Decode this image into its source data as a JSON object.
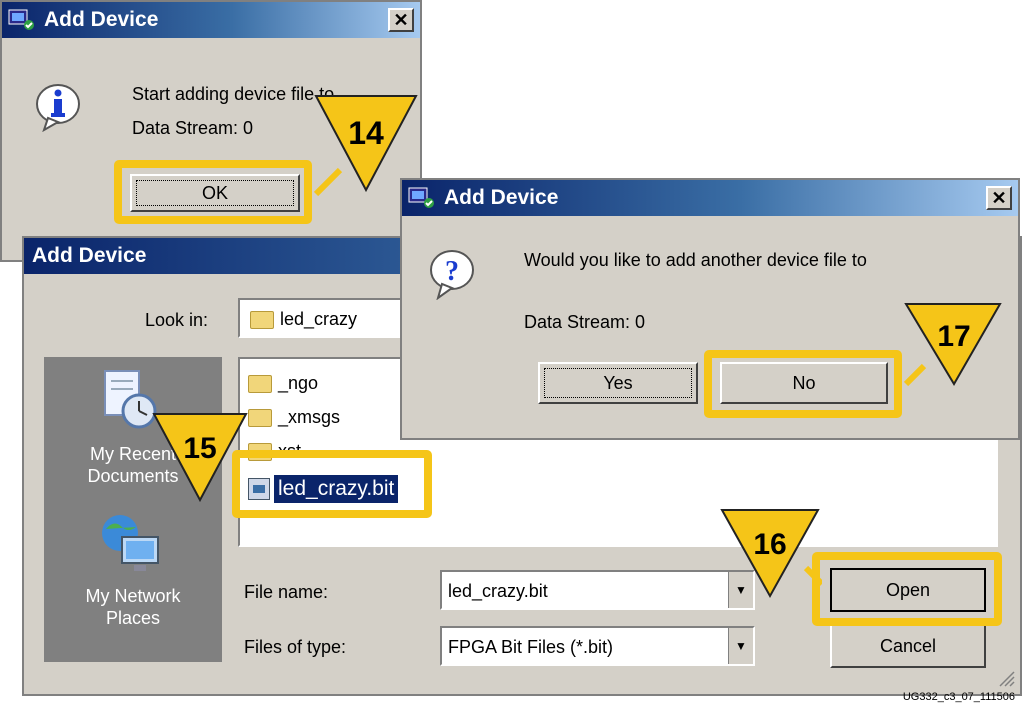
{
  "dialog_info": {
    "title": "Add Device",
    "message_line1": "Start adding device file to",
    "message_line2": "Data Stream: 0",
    "ok_label": "OK"
  },
  "dialog_open": {
    "title": "Add Device",
    "look_in_label": "Look in:",
    "look_in_value": "led_crazy",
    "places": [
      {
        "label_line1": "My Recent",
        "label_line2": "Documents",
        "icon": "recent-documents-icon"
      },
      {
        "label_line1": "My Network",
        "label_line2": "Places",
        "icon": "network-places-icon"
      }
    ],
    "files": [
      {
        "name": "_ngo",
        "icon": "folder-icon"
      },
      {
        "name": "_xmsgs",
        "icon": "folder-icon"
      },
      {
        "name": "xst",
        "icon": "folder-icon"
      },
      {
        "name": "led_crazy.bit",
        "icon": "bit-file-icon",
        "selected": true
      }
    ],
    "file_name_label": "File name:",
    "file_name_value": "led_crazy.bit",
    "files_of_type_label": "Files of type:",
    "files_of_type_value": "FPGA Bit Files (*.bit)",
    "open_label": "Open",
    "cancel_label": "Cancel"
  },
  "dialog_question": {
    "title": "Add Device",
    "message_line1": "Would you like to add another device file to",
    "message_line2": "Data Stream: 0",
    "yes_label": "Yes",
    "no_label": "No"
  },
  "callouts": {
    "c14": "14",
    "c15": "15",
    "c16": "16",
    "c17": "17"
  },
  "caption": "UG332_c3_07_111506",
  "colors": {
    "highlight": "#f5c518",
    "titlebar": "#0a246a",
    "dialog_bg": "#d4d0c8",
    "selection": "#0a246a"
  }
}
